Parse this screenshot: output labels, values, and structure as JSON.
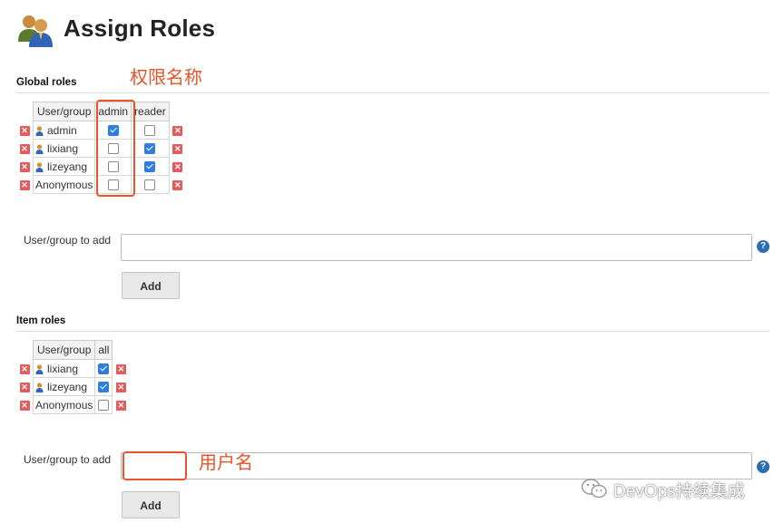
{
  "header": {
    "title": "Assign Roles",
    "icon": "users-icon"
  },
  "global_roles": {
    "section_title": "Global roles",
    "columns": [
      "User/group",
      "admin",
      "reader"
    ],
    "rows": [
      {
        "name": "admin",
        "has_icon": true,
        "checks": [
          true,
          false
        ]
      },
      {
        "name": "lixiang",
        "has_icon": true,
        "checks": [
          false,
          true
        ]
      },
      {
        "name": "lizeyang",
        "has_icon": true,
        "checks": [
          false,
          true
        ]
      },
      {
        "name": "Anonymous",
        "has_icon": false,
        "checks": [
          false,
          false
        ]
      }
    ],
    "add_label": "User/group to add",
    "add_value": "",
    "add_button": "Add"
  },
  "item_roles": {
    "section_title": "Item roles",
    "columns": [
      "User/group",
      "all"
    ],
    "rows": [
      {
        "name": "lixiang",
        "has_icon": true,
        "checks": [
          true
        ]
      },
      {
        "name": "lizeyang",
        "has_icon": true,
        "checks": [
          true
        ]
      },
      {
        "name": "Anonymous",
        "has_icon": false,
        "checks": [
          false
        ]
      }
    ],
    "add_label": "User/group to add",
    "add_value": "",
    "add_button": "Add"
  },
  "annotations": {
    "permission_name": "权限名称",
    "user_name": "用户名"
  },
  "watermark": {
    "text": "DevOps持续集成",
    "icon": "wechat-icon"
  },
  "colors": {
    "accent_checkbox": "#2f7de1",
    "delete_red": "#e35b5b",
    "annotation": "#e8542a",
    "help_blue": "#2a6fb3"
  }
}
